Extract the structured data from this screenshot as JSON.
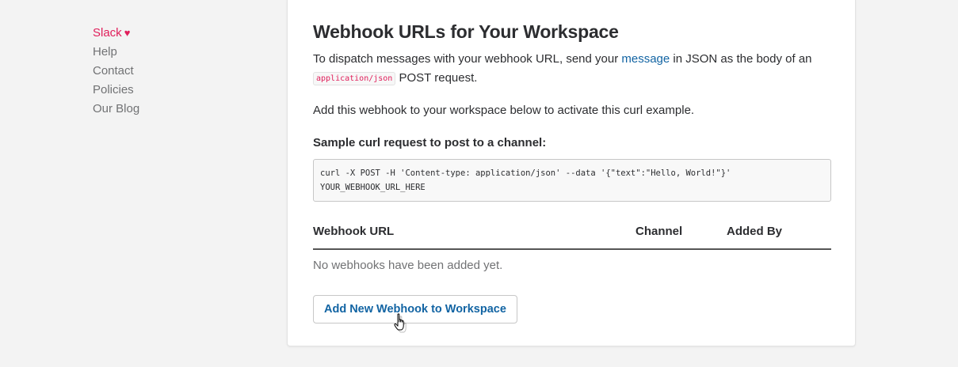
{
  "sidebar": {
    "brand": "Slack",
    "heart": "♥",
    "items": [
      {
        "label": "Help"
      },
      {
        "label": "Contact"
      },
      {
        "label": "Policies"
      },
      {
        "label": "Our Blog"
      }
    ]
  },
  "main": {
    "title": "Webhook URLs for Your Workspace",
    "intro_before_link": "To dispatch messages with your webhook URL, send your ",
    "intro_link": "message",
    "intro_after_link": " in JSON as the body of an ",
    "intro_code": "application/json",
    "intro_end": " POST request.",
    "activate_text": "Add this webhook to your workspace below to activate this curl example.",
    "sample_label": "Sample curl request to post to a channel:",
    "curl_line1": "curl -X POST -H 'Content-type: application/json' --data '{\"text\":\"Hello, World!\"}'",
    "curl_line2": "YOUR_WEBHOOK_URL_HERE",
    "table": {
      "columns": [
        "Webhook URL",
        "Channel",
        "Added By"
      ],
      "empty_text": "No webhooks have been added yet."
    },
    "add_button": "Add New Webhook to Workspace"
  },
  "colors": {
    "brand": "#e01e5a",
    "link": "#1264a3",
    "text": "#2c2d30",
    "muted": "#717274"
  },
  "icons": {
    "cursor": "hand-pointer-icon"
  }
}
